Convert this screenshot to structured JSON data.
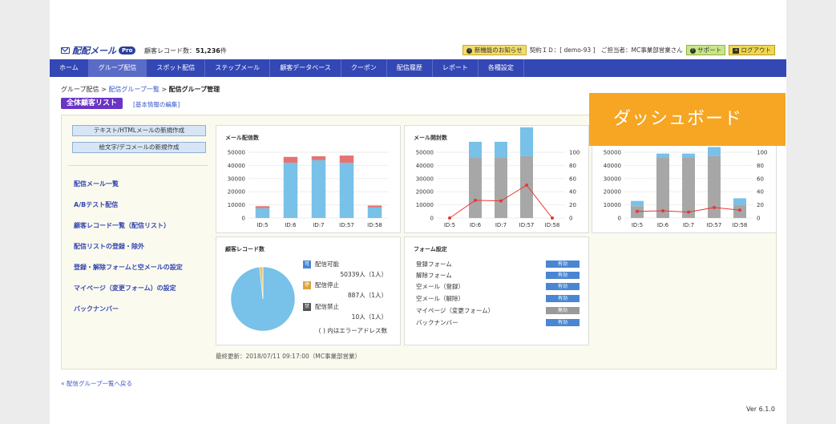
{
  "header": {
    "logo_text": "配配メール",
    "logo_badge": "Pro",
    "record_count_label": "顧客レコード数：",
    "record_count_value": "51,236",
    "record_count_unit": "件",
    "notice_button": "新機能のお知らせ",
    "contract_text": "契約ＩＤ：[ demo-93 ]　ご担当者：MC事業部営業さん",
    "support_button": "サポート",
    "logout_button": "ログアウト"
  },
  "nav": {
    "items": [
      "ホーム",
      "グループ配信",
      "スポット配信",
      "ステップメール",
      "顧客データベース",
      "クーポン",
      "配信履歴",
      "レポート",
      "各種設定"
    ],
    "active_index": 1
  },
  "breadcrumb": {
    "items": [
      "グループ配信",
      "配信グループ一覧",
      "配信グループ管理"
    ],
    "separator": ">"
  },
  "list_title": "全体顧客リスト",
  "edit_link": "[基本情報の編集]",
  "left": {
    "buttons": [
      "テキスト/HTMLメールの新規作成",
      "絵文字/デコメールの新規作成"
    ],
    "links": [
      "配信メール一覧",
      "A/Bテスト配信",
      "顧客レコード一覧（配信リスト）",
      "配信リストの登録・除外",
      "登録・解除フォームと空メールの設定",
      "マイページ（変更フォーム）の設定",
      "バックナンバー"
    ]
  },
  "cards": {
    "mail_count_title": "メール配信数",
    "open_count_title": "メール開封数",
    "records_title": "顧客レコード数",
    "form_title": "フォーム設定"
  },
  "chart_data": [
    {
      "type": "bar",
      "title": "メール配信数",
      "categories": [
        "ID:5",
        "ID:6",
        "ID:7",
        "ID:57",
        "ID:58"
      ],
      "series": [
        {
          "color": "#78c1e8",
          "values": [
            7500,
            42000,
            44000,
            42000,
            8000
          ]
        },
        {
          "color": "#e57373",
          "values": [
            1500,
            4500,
            3000,
            5500,
            1500
          ]
        }
      ],
      "ylim": [
        0,
        50000
      ],
      "yticks": [
        0,
        10000,
        20000,
        30000,
        40000,
        50000
      ]
    },
    {
      "type": "bar",
      "title": "メール開封数",
      "categories": [
        "ID:5",
        "ID:6",
        "ID:7",
        "ID:57",
        "ID:58"
      ],
      "series": [
        {
          "color": "#a7a7a7",
          "values": [
            0,
            46000,
            46000,
            47000,
            0
          ]
        },
        {
          "color": "#78c1e8",
          "values": [
            0,
            12000,
            12000,
            22000,
            0
          ]
        }
      ],
      "line": {
        "color": "#e53935",
        "values": [
          0,
          27,
          26,
          50,
          0
        ]
      },
      "ylim": [
        0,
        50000
      ],
      "yticks": [
        0,
        10000,
        20000,
        30000,
        40000,
        50000
      ],
      "y2lim": [
        0,
        100
      ],
      "y2ticks": [
        0,
        20,
        40,
        60,
        80,
        100
      ]
    },
    {
      "type": "bar",
      "categories": [
        "ID:5",
        "ID:6",
        "ID:7",
        "ID:57",
        "ID:58"
      ],
      "series": [
        {
          "color": "#a7a7a7",
          "values": [
            9000,
            46000,
            46000,
            47000,
            10000
          ]
        },
        {
          "color": "#78c1e8",
          "values": [
            4000,
            3000,
            3000,
            7000,
            5000
          ]
        }
      ],
      "line": {
        "color": "#e53935",
        "values": [
          10,
          11,
          9,
          16,
          12
        ]
      },
      "ylim": [
        0,
        50000
      ],
      "yticks": [
        0,
        10000,
        20000,
        30000,
        40000,
        50000
      ],
      "y2lim": [
        0,
        100
      ],
      "y2ticks": [
        0,
        20,
        40,
        60,
        80,
        100
      ]
    },
    {
      "type": "pie",
      "title": "顧客レコード数",
      "labels": [
        "配信可能",
        "配信停止",
        "配信禁止"
      ],
      "values": [
        50339,
        887,
        10
      ],
      "colors": [
        "#78c1e8",
        "#e9c46a",
        "#444444"
      ]
    }
  ],
  "records": {
    "items": [
      {
        "badge": "可",
        "color": "#4a86d2",
        "label": "配信可能",
        "value": "50339人（1人）"
      },
      {
        "badge": "停",
        "color": "#d9a441",
        "label": "配信停止",
        "value": "887人（1人）"
      },
      {
        "badge": "禁",
        "color": "#555555",
        "label": "配信禁止",
        "value": "10人（1人）"
      }
    ],
    "note": "( ) 内はエラーアドレス数"
  },
  "forms": {
    "items": [
      {
        "label": "登録フォーム",
        "status": "有効"
      },
      {
        "label": "解除フォーム",
        "status": "有効"
      },
      {
        "label": "空メール（登録）",
        "status": "有効"
      },
      {
        "label": "空メール（解除）",
        "status": "有効"
      },
      {
        "label": "マイページ（変更フォーム）",
        "status": "無効"
      },
      {
        "label": "バックナンバー",
        "status": "有効"
      }
    ]
  },
  "last_updated": "最終更新：2018/07/11 09:17:00（MC事業部営業）",
  "back_link": "« 配信グループ一覧へ戻る",
  "version": "Ver 6.1.0",
  "overlay_text": "ダッシュボード"
}
